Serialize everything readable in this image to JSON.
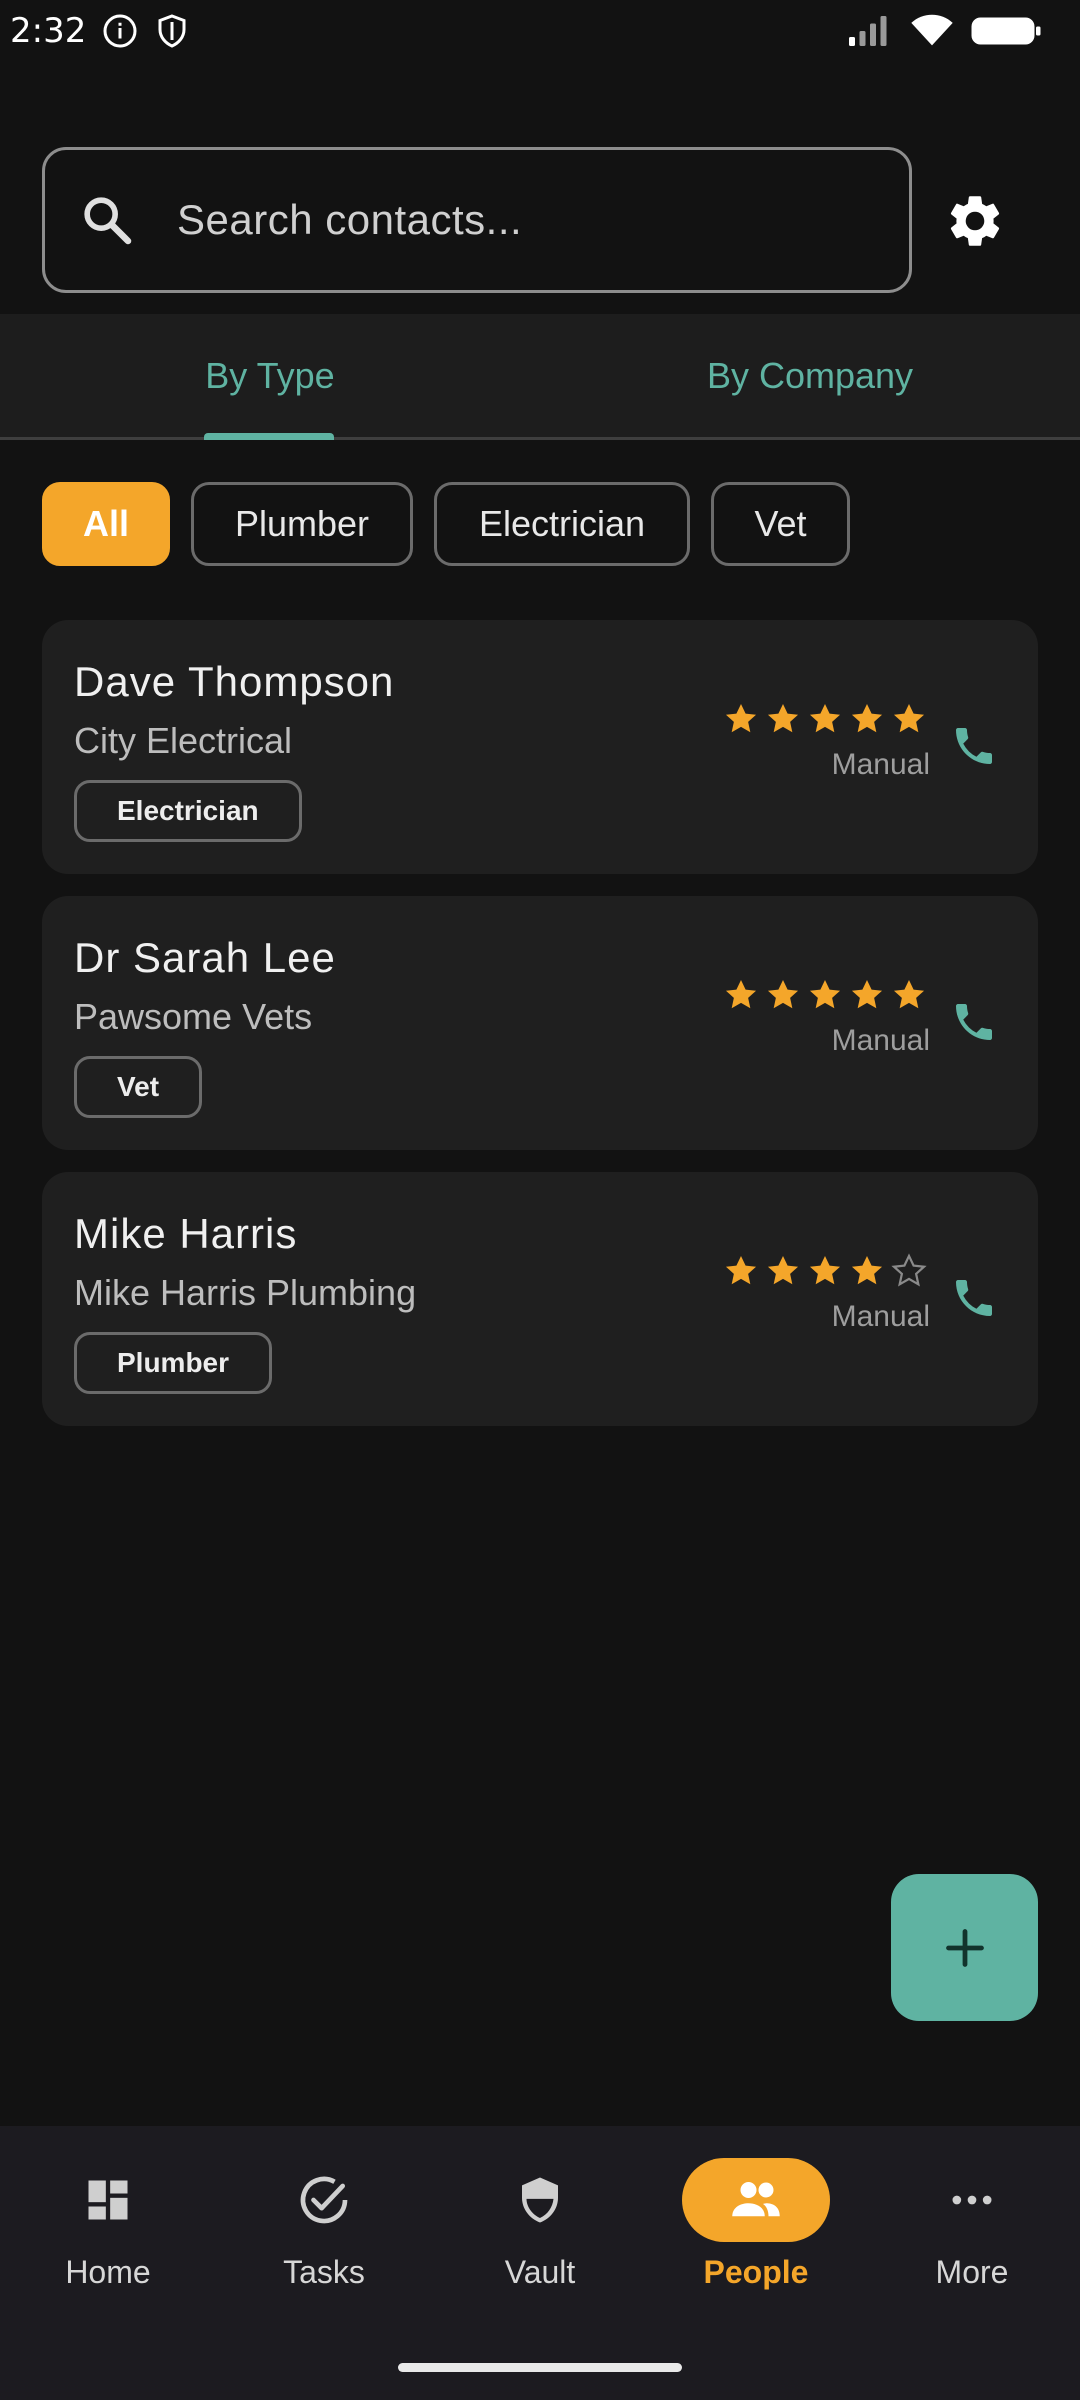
{
  "status_bar": {
    "time": "2:32",
    "icons": [
      "info-icon",
      "shield-icon",
      "signal-icon",
      "wifi-icon",
      "battery-icon"
    ]
  },
  "search": {
    "placeholder": "Search contacts...",
    "value": ""
  },
  "tabs": [
    {
      "label": "By Type",
      "selected": true
    },
    {
      "label": "By Company",
      "selected": false
    }
  ],
  "filters": [
    {
      "label": "All",
      "selected": true
    },
    {
      "label": "Plumber",
      "selected": false
    },
    {
      "label": "Electrician",
      "selected": false
    },
    {
      "label": "Vet",
      "selected": false
    }
  ],
  "contacts": [
    {
      "name": "Dave Thompson",
      "company": "City Electrical",
      "type": "Electrician",
      "rating": 5,
      "rating_source": "Manual"
    },
    {
      "name": "Dr Sarah Lee",
      "company": "Pawsome Vets",
      "type": "Vet",
      "rating": 5,
      "rating_source": "Manual"
    },
    {
      "name": "Mike Harris",
      "company": "Mike Harris Plumbing",
      "type": "Plumber",
      "rating": 4,
      "rating_source": "Manual"
    }
  ],
  "fab": {
    "icon": "plus-icon"
  },
  "bottom_nav": [
    {
      "label": "Home",
      "icon": "dashboard-icon",
      "active": false
    },
    {
      "label": "Tasks",
      "icon": "check-circle-icon",
      "active": false
    },
    {
      "label": "Vault",
      "icon": "shield-icon",
      "active": false
    },
    {
      "label": "People",
      "icon": "people-icon",
      "active": true
    },
    {
      "label": "More",
      "icon": "more-horizontal-icon",
      "active": false
    }
  ],
  "colors": {
    "accent": "#f4a62a",
    "teal": "#5fb3a2",
    "background": "#121212",
    "card": "#1f1f1f"
  }
}
